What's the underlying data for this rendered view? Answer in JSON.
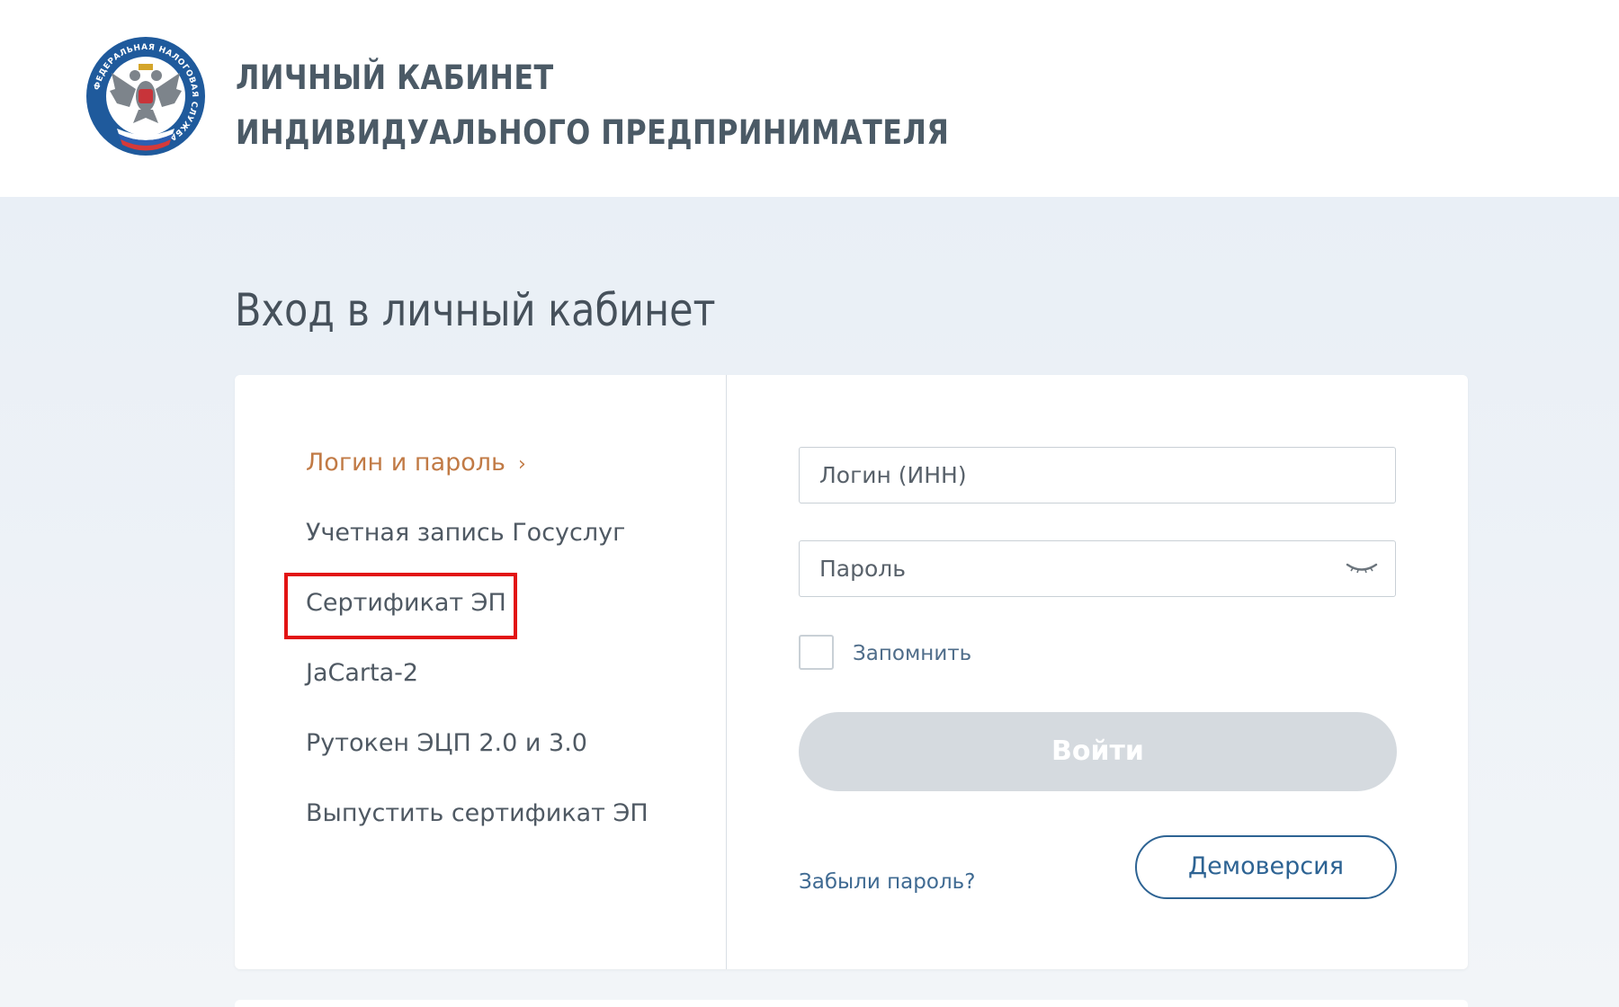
{
  "header": {
    "title_line1": "ЛИЧНЫЙ КАБИНЕТ",
    "title_line2": "ИНДИВИДУАЛЬНОГО ПРЕДПРИНИМАТЕЛЯ",
    "emblem_text": "ФЕДЕРАЛЬНАЯ НАЛОГОВАЯ СЛУЖБА"
  },
  "main": {
    "page_title": "Вход в личный кабинет",
    "methods": [
      {
        "label": "Логин и пароль",
        "active": true
      },
      {
        "label": "Учетная запись Госуслуг",
        "active": false
      },
      {
        "label": "Сертификат ЭП",
        "active": false,
        "highlighted": true
      },
      {
        "label": "JaCarta-2",
        "active": false
      },
      {
        "label": "Рутокен ЭЦП 2.0 и 3.0",
        "active": false
      },
      {
        "label": "Выпустить сертификат ЭП",
        "active": false
      }
    ],
    "form": {
      "login_placeholder": "Логин (ИНН)",
      "login_value": "",
      "password_placeholder": "Пароль",
      "password_value": "",
      "remember_label": "Запомнить",
      "remember_checked": false,
      "login_button": "Войти",
      "forgot_link": "Забыли пароль?",
      "demo_button": "Демоверсия"
    }
  },
  "colors": {
    "active_method": "#c17a45",
    "highlight": "#e21313",
    "link": "#3f6a92",
    "disabled_button": "#d5dadf"
  },
  "icons": {
    "active_chevron": "chevron-right-icon",
    "password_toggle": "eye-closed-icon",
    "emblem": "fns-emblem-icon"
  }
}
